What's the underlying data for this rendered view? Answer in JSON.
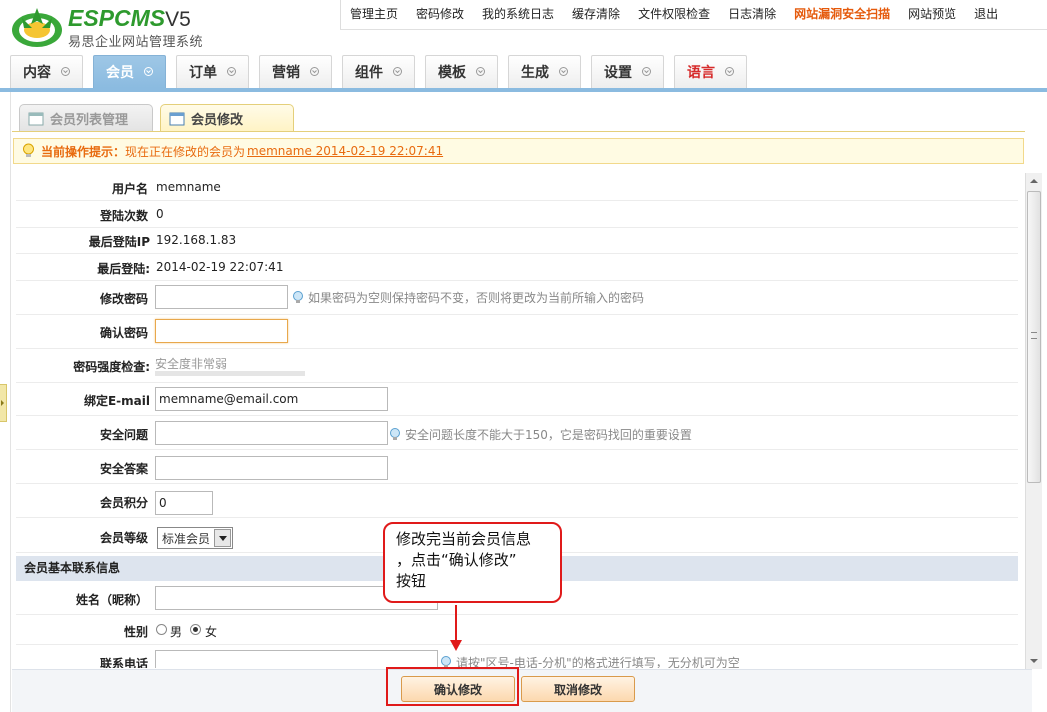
{
  "logo": {
    "esp": "ESP",
    "cms": "CMS",
    "version": "V5",
    "subtitle": "易思企业网站管理系统"
  },
  "toplinks": [
    "管理主页",
    "密码修改",
    "我的系统日志",
    "缓存清除",
    "文件权限检查",
    "日志清除",
    "网站漏洞安全扫描",
    "网站预览",
    "退出"
  ],
  "mainnav": [
    "内容",
    "会员",
    "订单",
    "营销",
    "组件",
    "模板",
    "生成",
    "设置",
    "语言"
  ],
  "subtabs": {
    "list": "会员列表管理",
    "edit": "会员修改"
  },
  "tip": {
    "label": "当前操作提示：",
    "message": "现在正在修改的会员为",
    "member": "memname 2014-02-19 22:07:41"
  },
  "form": {
    "username_label": "用户名",
    "username_value": "memname",
    "login_count_label": "登陆次数",
    "login_count_value": "0",
    "last_ip_label": "最后登陆IP",
    "last_ip_value": "192.168.1.83",
    "last_login_label": "最后登陆:",
    "last_login_value": "2014-02-19 22:07:41",
    "password_label": "修改密码",
    "password_hint": "如果密码为空则保持密码不变，否则将更改为当前所输入的密码",
    "confirm_label": "确认密码",
    "strength_label": "密码强度检查:",
    "strength_value": "安全度非常弱",
    "email_label": "绑定E-mail",
    "email_value": "memname@email.com",
    "question_label": "安全问题",
    "question_hint": "安全问题长度不能大于150，它是密码找回的重要设置",
    "answer_label": "安全答案",
    "points_label": "会员积分",
    "points_value": "0",
    "level_label": "会员等级",
    "level_value": "标准会员",
    "section_contact": "会员基本联系信息",
    "nickname_label": "姓名（昵称）",
    "gender_label": "性别",
    "gender_male": "男",
    "gender_female": "女",
    "phone_label": "联系电话",
    "phone_hint": "请按\"区号-电话-分机\"的格式进行填写，无分机可为空"
  },
  "buttons": {
    "confirm": "确认修改",
    "cancel": "取消修改"
  },
  "callout": {
    "line1": "修改完当前会员信息",
    "line2": "，点击“确认修改”",
    "line3": "按钮"
  },
  "colors": {
    "accent_blue": "#8bbbe0",
    "warning_orange": "#e86b10",
    "annotation_red": "#e01a1a"
  }
}
